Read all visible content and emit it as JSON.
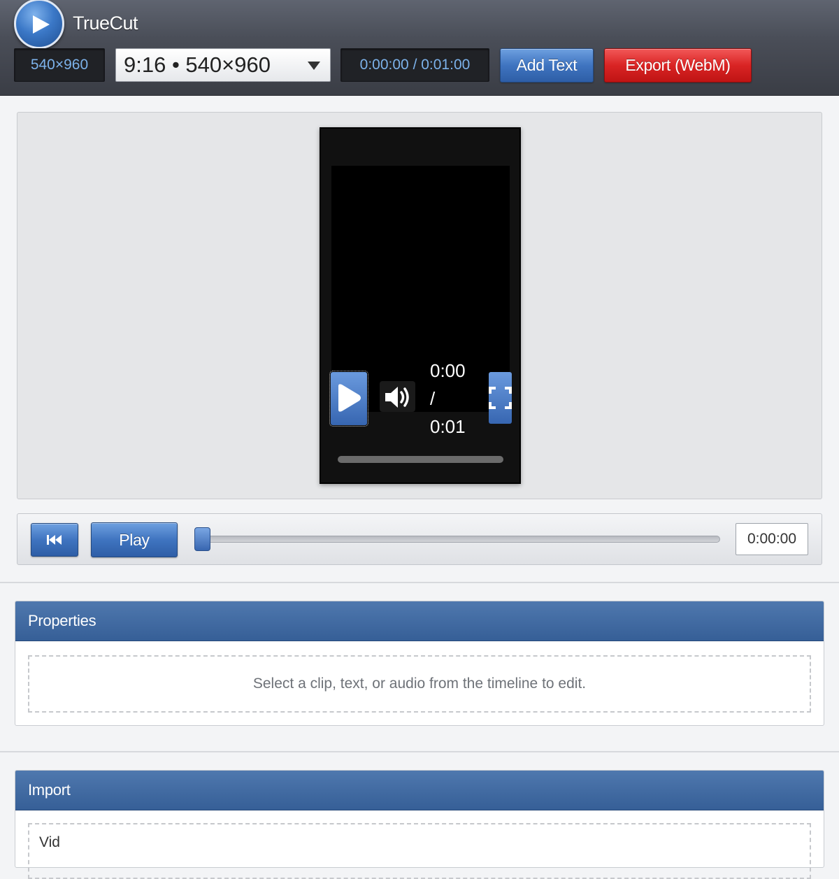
{
  "app": {
    "title": "TrueCut"
  },
  "toolbar": {
    "resolution": "540×960",
    "aspect_select": "9:16 • 540×960",
    "timecode": "0:00:00 / 0:01:00",
    "add_text_label": "Add Text",
    "export_label": "Export (WebM)"
  },
  "player": {
    "current_time": "0:00",
    "separator": "/",
    "duration": "0:01",
    "progress": 0
  },
  "transport": {
    "play_label": "Play",
    "time_value": "0:00:00",
    "scrub_position": 0
  },
  "properties": {
    "title": "Properties",
    "empty_message": "Select a clip, text, or audio from the timeline to edit."
  },
  "import": {
    "title": "Import",
    "first_label": "Vid"
  },
  "colors": {
    "accent_blue": "#3f74c0",
    "export_red": "#d92424",
    "timecode_text": "#7cb2ea",
    "panel_header": "#436b9f"
  },
  "icons": {
    "logo": "play-triangle-icon",
    "rewind": "skip-back-icon",
    "player_play": "play-icon",
    "volume": "volume-icon",
    "fullscreen": "fullscreen-icon",
    "select_caret": "chevron-down-icon"
  }
}
